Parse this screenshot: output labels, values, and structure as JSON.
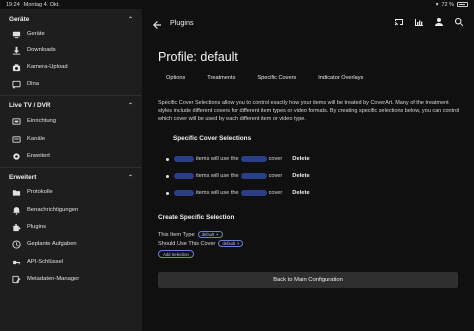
{
  "status_bar": {
    "time": "19:24",
    "date": "Montag 4. Okt.",
    "battery": "72 %"
  },
  "sidebar": {
    "sections": [
      {
        "title": "Geräte",
        "items": [
          {
            "label": "Geräte",
            "icon": "devices-icon"
          },
          {
            "label": "Downloads",
            "icon": "download-icon"
          },
          {
            "label": "Kamera-Upload",
            "icon": "camera-icon"
          },
          {
            "label": "Dlna",
            "icon": "cast-icon"
          }
        ]
      },
      {
        "title": "Live TV / DVR",
        "items": [
          {
            "label": "Einrichtung",
            "icon": "tv-icon"
          },
          {
            "label": "Kanäle",
            "icon": "list-icon"
          },
          {
            "label": "Erweitert",
            "icon": "gear-icon"
          }
        ]
      },
      {
        "title": "Erweitert",
        "items": [
          {
            "label": "Protokolle",
            "icon": "folder-icon"
          },
          {
            "label": "Benachrichtigungen",
            "icon": "bell-icon"
          },
          {
            "label": "Plugins",
            "icon": "plugin-icon"
          },
          {
            "label": "Geplante Aufgaben",
            "icon": "clock-icon"
          },
          {
            "label": "API-Schlüssel",
            "icon": "key-icon"
          },
          {
            "label": "Metadaten-Manager",
            "icon": "edit-icon"
          }
        ]
      }
    ]
  },
  "header": {
    "title": "Plugins"
  },
  "page": {
    "title": "Profile: default",
    "tabs": [
      "Options",
      "Treatments",
      "Specific Covers",
      "Indicator Overlays"
    ],
    "description": "Specific Cover Selections allow you to control exactly how your items will be treated by CoverArt. Many of the treatment styles include different covers for different item types or video formats. By creating specific selections below, you can control which cover will be used by each different item or video type.",
    "selections_heading": "Specific Cover Selections",
    "rules": [
      {
        "pre": "items will use the",
        "post": "cover",
        "delete": "Delete"
      },
      {
        "pre": "items will use the",
        "post": "cover",
        "delete": "Delete"
      },
      {
        "pre": "items will use the",
        "post": "cover",
        "delete": "Delete"
      }
    ],
    "create_heading": "Create Specific Selection",
    "item_type_label": "This Item Type",
    "item_type_chip": "default",
    "use_cover_label": "Should Use This Cover",
    "use_cover_chip": "default",
    "add_selection": "Add Selection",
    "back_button": "Back to Main Configuration"
  }
}
